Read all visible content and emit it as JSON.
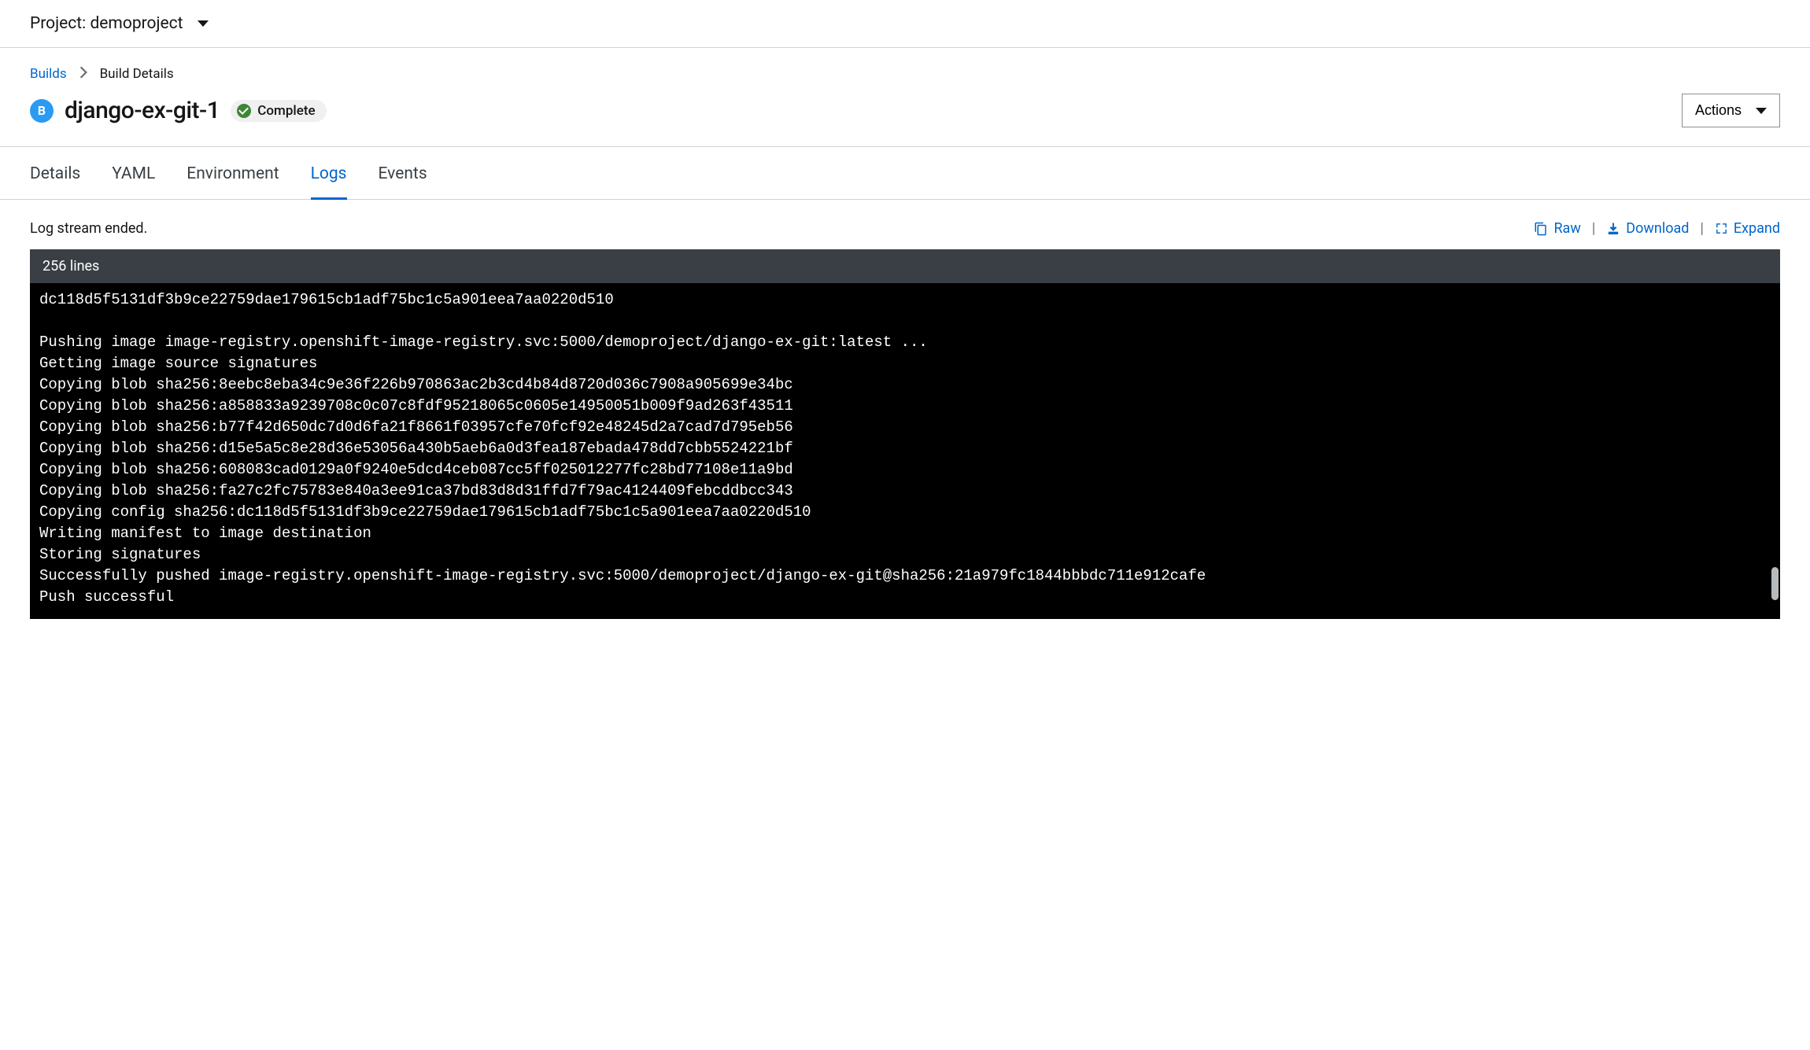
{
  "header": {
    "project_label": "Project: demoproject"
  },
  "breadcrumb": {
    "root": "Builds",
    "current": "Build Details"
  },
  "title": {
    "icon_letter": "B",
    "name": "django-ex-git-1",
    "status": "Complete"
  },
  "actions_label": "Actions",
  "tabs": {
    "details": "Details",
    "yaml": "YAML",
    "environment": "Environment",
    "logs": "Logs",
    "events": "Events"
  },
  "log_toolbar": {
    "status": "Log stream ended.",
    "raw": "Raw",
    "download": "Download",
    "expand": "Expand",
    "line_count": "256 lines"
  },
  "log_lines": [
    "dc118d5f5131df3b9ce22759dae179615cb1adf75bc1c5a901eea7aa0220d510",
    "",
    "Pushing image image-registry.openshift-image-registry.svc:5000/demoproject/django-ex-git:latest ...",
    "Getting image source signatures",
    "Copying blob sha256:8eebc8eba34c9e36f226b970863ac2b3cd4b84d8720d036c7908a905699e34bc",
    "Copying blob sha256:a858833a9239708c0c07c8fdf95218065c0605e14950051b009f9ad263f43511",
    "Copying blob sha256:b77f42d650dc7d0d6fa21f8661f03957cfe70fcf92e48245d2a7cad7d795eb56",
    "Copying blob sha256:d15e5a5c8e28d36e53056a430b5aeb6a0d3fea187ebada478dd7cbb5524221bf",
    "Copying blob sha256:608083cad0129a0f9240e5dcd4ceb087cc5ff025012277fc28bd77108e11a9bd",
    "Copying blob sha256:fa27c2fc75783e840a3ee91ca37bd83d8d31ffd7f79ac4124409febcddbcc343",
    "Copying config sha256:dc118d5f5131df3b9ce22759dae179615cb1adf75bc1c5a901eea7aa0220d510",
    "Writing manifest to image destination",
    "Storing signatures",
    "Successfully pushed image-registry.openshift-image-registry.svc:5000/demoproject/django-ex-git@sha256:21a979fc1844bbbdc711e912cafe",
    "Push successful"
  ]
}
